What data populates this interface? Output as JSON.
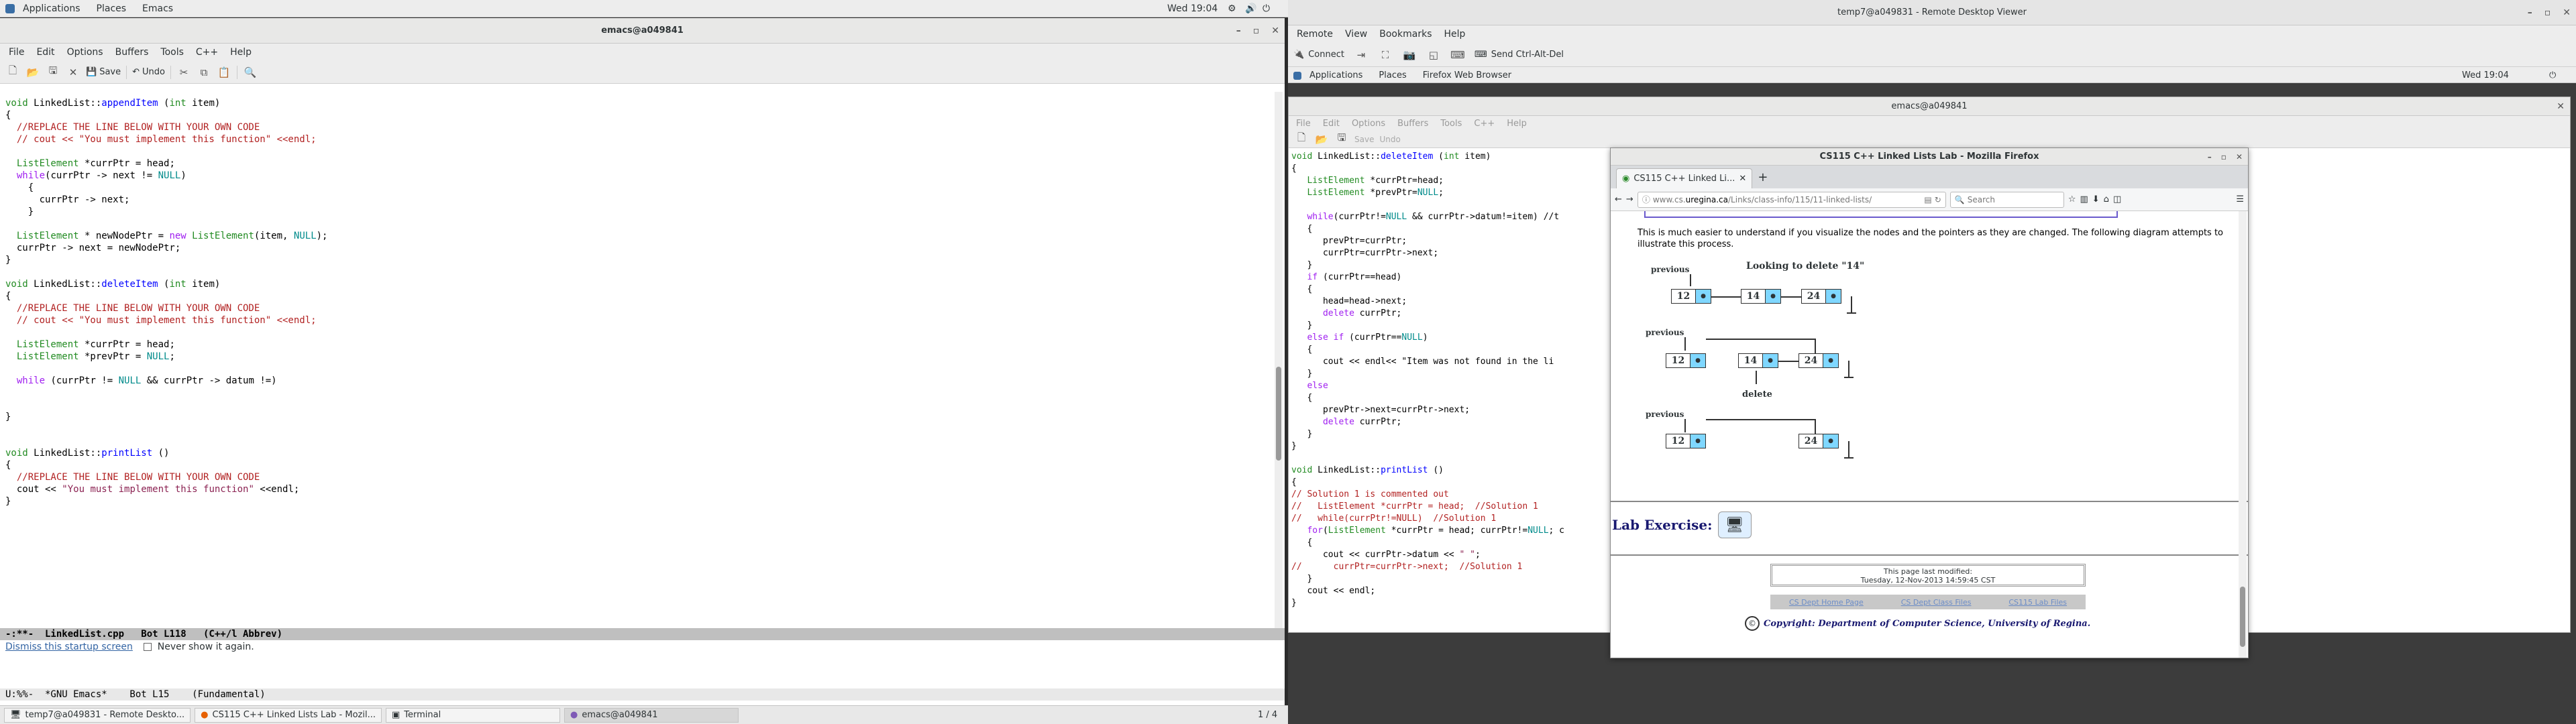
{
  "left_panel": {
    "applications": "Applications",
    "places": "Places",
    "app": "Emacs",
    "clock": "Wed 19:04"
  },
  "left_window": {
    "title": "emacs@a049841",
    "menu": [
      "File",
      "Edit",
      "Options",
      "Buffers",
      "Tools",
      "C++",
      "Help"
    ],
    "toolbar": {
      "save": "Save",
      "undo": "Undo"
    },
    "code_lines": [
      "void LinkedList::appendItem (int item)",
      "{",
      "  //REPLACE THE LINE BELOW WITH YOUR OWN CODE",
      "  // cout << \"You must implement this function\" <<endl;",
      "",
      "  ListElement *currPtr = head;",
      "  while(currPtr -> next != NULL)",
      "    {",
      "      currPtr -> next;",
      "    }",
      "",
      "  ListElement * newNodePtr = new ListElement(item, NULL);",
      "  currPtr -> next = newNodePtr;",
      "}",
      "",
      "void LinkedList::deleteItem (int item)",
      "{",
      "  //REPLACE THE LINE BELOW WITH YOUR OWN CODE",
      "  // cout << \"You must implement this function\" <<endl;",
      "",
      "  ListElement *currPtr = head;",
      "  ListElement *prevPtr = NULL;",
      "",
      "  while (currPtr != NULL && currPtr -> datum !=)",
      "",
      "",
      "}",
      "",
      "",
      "void LinkedList::printList ()",
      "{",
      "  //REPLACE THE LINE BELOW WITH YOUR OWN CODE",
      "  cout << \"You must implement this function\" <<endl;",
      "}"
    ],
    "modeline": "-:**-  LinkedList.cpp   Bot L118   (C++/l Abbrev)",
    "startup_link": "Dismiss this startup screen",
    "never_show": "Never show it again.",
    "modeline2": "U:%%-  *GNU Emacs*    Bot L15    (Fundamental)"
  },
  "taskbar": {
    "items": [
      "temp7@a049831 - Remote Deskto...",
      "CS115 C++ Linked Lists Lab - Mozil...",
      "Terminal",
      "emacs@a049841"
    ],
    "pager": "1 / 4"
  },
  "right_window": {
    "title": "temp7@a049831 - Remote Desktop Viewer",
    "menu": [
      "Remote",
      "View",
      "Bookmarks",
      "Help"
    ],
    "toolbar": {
      "connect": "Connect",
      "send_keys": "Send Ctrl-Alt-Del"
    },
    "inner_panel": {
      "applications": "Applications",
      "places": "Places",
      "app": "Firefox Web Browser",
      "clock": "Wed 19:04"
    },
    "inner_emacs": {
      "title": "emacs@a049841",
      "menu": [
        "File",
        "Edit",
        "Options",
        "Buffers",
        "Tools",
        "C++",
        "Help"
      ],
      "toolbar": {
        "save": "Save",
        "undo": "Undo"
      },
      "code_lines": [
        "void LinkedList::deleteItem (int item)",
        "{",
        "   ListElement *currPtr=head;",
        "   ListElement *prevPtr=NULL;",
        "",
        "   while(currPtr!=NULL && currPtr->datum!=item) //t",
        "   {",
        "      prevPtr=currPtr;",
        "      currPtr=currPtr->next;",
        "   }",
        "   if (currPtr==head)",
        "   {",
        "      head=head->next;",
        "      delete currPtr;",
        "   }",
        "   else if (currPtr==NULL)",
        "   {",
        "      cout << endl<< \"Item was not found in the li",
        "   }",
        "   else",
        "   {",
        "      prevPtr->next=currPtr->next;",
        "      delete currPtr;",
        "   }",
        "}",
        "",
        "void LinkedList::printList ()",
        "{",
        "// Solution 1 is commented out",
        "//   ListElement *currPtr = head;  //Solution 1",
        "//   while(currPtr!=NULL)  //Solution 1",
        "   for(ListElement *currPtr = head; currPtr!=NULL; c",
        "   {",
        "      cout << currPtr->datum << \" \";",
        "//      currPtr=currPtr->next;  //Solution 1",
        "   }",
        "   cout << endl;",
        "}"
      ]
    },
    "firefox": {
      "title": "CS115 C++ Linked Lists Lab - Mozilla Firefox",
      "tab": "CS115 C++ Linked Li...",
      "url_prefix": "www.cs.",
      "url_domain": "uregina.ca",
      "url_suffix": "/Links/class-info/115/11-linked-lists/",
      "search_placeholder": "Search",
      "paragraph": "This is much easier to understand if you visualize the nodes and the pointers as they are changed. The following diagram attempts to illustrate this process.",
      "diagram": {
        "heading": "Looking to delete \"14\"",
        "previous_label": "previous",
        "delete_label": "delete",
        "row1": [
          "12",
          "14",
          "24"
        ],
        "row2": [
          "12",
          "14",
          "24"
        ],
        "row3": [
          "12",
          "24"
        ]
      },
      "lab_exercise": "Lab Exercise:",
      "modified_line1": "This page last modified:",
      "modified_line2": "Tuesday, 12-Nov-2013 14:59:45 CST",
      "footer_links": [
        "CS Dept Home Page",
        "CS Dept Class Files",
        "CS115 Lab Files"
      ],
      "copyright": "Copyright: Department of Computer Science, University of Regina."
    }
  }
}
